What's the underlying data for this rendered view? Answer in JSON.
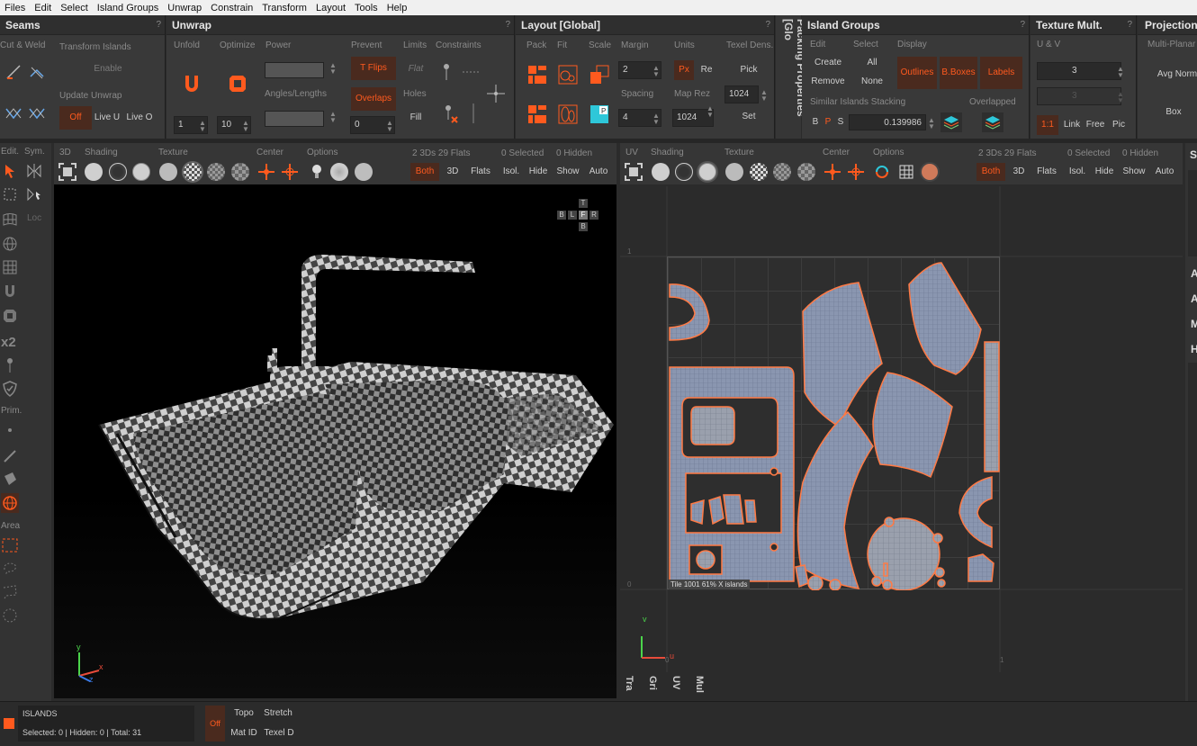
{
  "menubar": [
    "Files",
    "Edit",
    "Select",
    "Island Groups",
    "Unwrap",
    "Constrain",
    "Transform",
    "Layout",
    "Tools",
    "Help"
  ],
  "seams": {
    "title": "Seams",
    "q": "?",
    "cut_weld": "Cut & Weld",
    "transform_islands": "Transform Islands",
    "enable": "Enable",
    "update_unwrap": "Update Unwrap",
    "off": "Off",
    "live_u": "Live U",
    "live_o": "Live O"
  },
  "unwrap": {
    "title": "Unwrap",
    "q": "?",
    "unfold": "Unfold",
    "optimize": "Optimize",
    "power": "Power",
    "prevent": "Prevent",
    "limits": "Limits",
    "constraints": "Constraints",
    "t_flips": "T Flips",
    "flat": "Flat",
    "angles_lengths": "Angles/Lengths",
    "overlaps": "Overlaps",
    "holes": "Holes",
    "fill": "Fill",
    "unfold_iter": "1",
    "optimize_iter": "10",
    "prevent_val": "0"
  },
  "layout": {
    "title": "Layout [Global]",
    "q": "?",
    "pack": "Pack",
    "fit": "Fit",
    "scale": "Scale",
    "margin": "Margin",
    "units": "Units",
    "texel_dens": "Texel Dens.",
    "margin_val": "2",
    "px": "Px",
    "re": "Re",
    "pick": "Pick",
    "spacing": "Spacing",
    "map_rez": "Map Rez",
    "map_rez_val": "1024",
    "texel_val": "1024",
    "spacing_val": "4",
    "set": "Set"
  },
  "packing_tab": "Packing Properties [Glo",
  "island_groups": {
    "title": "Island Groups",
    "q": "?",
    "edit": "Edit",
    "select": "Select",
    "display": "Display",
    "create": "Create",
    "all": "All",
    "remove": "Remove",
    "none": "None",
    "outlines": "Outlines",
    "bboxes": "B.Boxes",
    "labels": "Labels",
    "similar": "Similar Islands Stacking",
    "overlapped": "Overlapped",
    "b": "B",
    "p": "P",
    "s": "S",
    "sim_val": "0.139986"
  },
  "texture_mult": {
    "title": "Texture Mult.",
    "q": "?",
    "uv": "U & V",
    "val1": "3",
    "val2": "3",
    "ratio": "1:1",
    "link": "Link",
    "free": "Free",
    "pic": "Pic"
  },
  "projection": {
    "title": "Projection",
    "multi_planar": "Multi-Planar",
    "avg_norm": "Avg Norm",
    "box": "Box"
  },
  "left_toolbar": {
    "edit": "Edit.",
    "sym": "Sym.",
    "loc": "Loc",
    "x2": "x2",
    "prim": "Prim.",
    "area": "Area"
  },
  "viewport3d": {
    "tab3d": "3D",
    "shading": "Shading",
    "texture": "Texture",
    "center": "Center",
    "options": "Options",
    "count": "2 3Ds 29 Flats",
    "selected": "0 Selected",
    "hidden": "0 Hidden",
    "both": "Both",
    "three_d": "3D",
    "flats": "Flats",
    "isol": "Isol.",
    "hide": "Hide",
    "show": "Show",
    "auto": "Auto",
    "cube": {
      "t": "T",
      "b": "B",
      "l": "L",
      "f": "F",
      "r": "R",
      "bb": "B"
    },
    "axis_y": "y",
    "axis_x": "x",
    "axis_z": "z"
  },
  "viewportuv": {
    "tab_uv": "UV",
    "shading": "Shading",
    "texture": "Texture",
    "center": "Center",
    "options": "Options",
    "count": "2 3Ds 29 Flats",
    "selected": "0 Selected",
    "hidden": "0 Hidden",
    "both": "Both",
    "three_d": "3D",
    "flats": "Flats",
    "isol": "Isol.",
    "hide": "Hide",
    "show": "Show",
    "auto": "Auto",
    "tile_label": "Tile 1001 61%   X   islands",
    "grid_one": "1",
    "grid_zero": "0",
    "axis_zero": "0",
    "axis_one": "1",
    "axis_u": "u",
    "axis_v": "v",
    "vtabs": [
      "Tra",
      "Gri",
      "UV",
      "Mul"
    ]
  },
  "right_panel": {
    "s": "S",
    "a1": "A",
    "a2": "A",
    "m": "M",
    "h": "H"
  },
  "status": {
    "islands": "ISLANDS",
    "info": "Selected: 0 | Hidden: 0 | Total: 31",
    "off": "Off",
    "topo": "Topo",
    "stretch": "Stretch",
    "mat_id": "Mat ID",
    "texel_d": "Texel D"
  },
  "colors": {
    "accent": "#ff5a1e",
    "uv_island": "#8a96b0",
    "bg": "#2b2b2b"
  }
}
